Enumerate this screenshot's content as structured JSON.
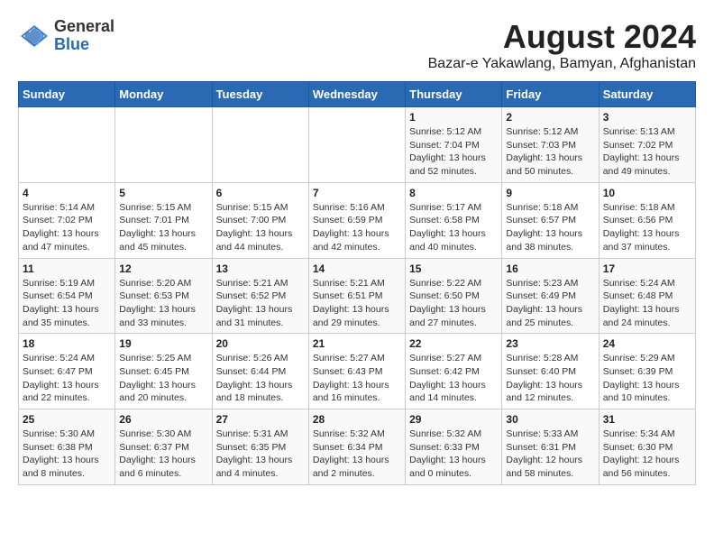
{
  "logo": {
    "general": "General",
    "blue": "Blue"
  },
  "title": "August 2024",
  "subtitle": "Bazar-e Yakawlang, Bamyan, Afghanistan",
  "calendar": {
    "headers": [
      "Sunday",
      "Monday",
      "Tuesday",
      "Wednesday",
      "Thursday",
      "Friday",
      "Saturday"
    ],
    "weeks": [
      [
        {
          "day": "",
          "info": ""
        },
        {
          "day": "",
          "info": ""
        },
        {
          "day": "",
          "info": ""
        },
        {
          "day": "",
          "info": ""
        },
        {
          "day": "1",
          "info": "Sunrise: 5:12 AM\nSunset: 7:04 PM\nDaylight: 13 hours\nand 52 minutes."
        },
        {
          "day": "2",
          "info": "Sunrise: 5:12 AM\nSunset: 7:03 PM\nDaylight: 13 hours\nand 50 minutes."
        },
        {
          "day": "3",
          "info": "Sunrise: 5:13 AM\nSunset: 7:02 PM\nDaylight: 13 hours\nand 49 minutes."
        }
      ],
      [
        {
          "day": "4",
          "info": "Sunrise: 5:14 AM\nSunset: 7:02 PM\nDaylight: 13 hours\nand 47 minutes."
        },
        {
          "day": "5",
          "info": "Sunrise: 5:15 AM\nSunset: 7:01 PM\nDaylight: 13 hours\nand 45 minutes."
        },
        {
          "day": "6",
          "info": "Sunrise: 5:15 AM\nSunset: 7:00 PM\nDaylight: 13 hours\nand 44 minutes."
        },
        {
          "day": "7",
          "info": "Sunrise: 5:16 AM\nSunset: 6:59 PM\nDaylight: 13 hours\nand 42 minutes."
        },
        {
          "day": "8",
          "info": "Sunrise: 5:17 AM\nSunset: 6:58 PM\nDaylight: 13 hours\nand 40 minutes."
        },
        {
          "day": "9",
          "info": "Sunrise: 5:18 AM\nSunset: 6:57 PM\nDaylight: 13 hours\nand 38 minutes."
        },
        {
          "day": "10",
          "info": "Sunrise: 5:18 AM\nSunset: 6:56 PM\nDaylight: 13 hours\nand 37 minutes."
        }
      ],
      [
        {
          "day": "11",
          "info": "Sunrise: 5:19 AM\nSunset: 6:54 PM\nDaylight: 13 hours\nand 35 minutes."
        },
        {
          "day": "12",
          "info": "Sunrise: 5:20 AM\nSunset: 6:53 PM\nDaylight: 13 hours\nand 33 minutes."
        },
        {
          "day": "13",
          "info": "Sunrise: 5:21 AM\nSunset: 6:52 PM\nDaylight: 13 hours\nand 31 minutes."
        },
        {
          "day": "14",
          "info": "Sunrise: 5:21 AM\nSunset: 6:51 PM\nDaylight: 13 hours\nand 29 minutes."
        },
        {
          "day": "15",
          "info": "Sunrise: 5:22 AM\nSunset: 6:50 PM\nDaylight: 13 hours\nand 27 minutes."
        },
        {
          "day": "16",
          "info": "Sunrise: 5:23 AM\nSunset: 6:49 PM\nDaylight: 13 hours\nand 25 minutes."
        },
        {
          "day": "17",
          "info": "Sunrise: 5:24 AM\nSunset: 6:48 PM\nDaylight: 13 hours\nand 24 minutes."
        }
      ],
      [
        {
          "day": "18",
          "info": "Sunrise: 5:24 AM\nSunset: 6:47 PM\nDaylight: 13 hours\nand 22 minutes."
        },
        {
          "day": "19",
          "info": "Sunrise: 5:25 AM\nSunset: 6:45 PM\nDaylight: 13 hours\nand 20 minutes."
        },
        {
          "day": "20",
          "info": "Sunrise: 5:26 AM\nSunset: 6:44 PM\nDaylight: 13 hours\nand 18 minutes."
        },
        {
          "day": "21",
          "info": "Sunrise: 5:27 AM\nSunset: 6:43 PM\nDaylight: 13 hours\nand 16 minutes."
        },
        {
          "day": "22",
          "info": "Sunrise: 5:27 AM\nSunset: 6:42 PM\nDaylight: 13 hours\nand 14 minutes."
        },
        {
          "day": "23",
          "info": "Sunrise: 5:28 AM\nSunset: 6:40 PM\nDaylight: 13 hours\nand 12 minutes."
        },
        {
          "day": "24",
          "info": "Sunrise: 5:29 AM\nSunset: 6:39 PM\nDaylight: 13 hours\nand 10 minutes."
        }
      ],
      [
        {
          "day": "25",
          "info": "Sunrise: 5:30 AM\nSunset: 6:38 PM\nDaylight: 13 hours\nand 8 minutes."
        },
        {
          "day": "26",
          "info": "Sunrise: 5:30 AM\nSunset: 6:37 PM\nDaylight: 13 hours\nand 6 minutes."
        },
        {
          "day": "27",
          "info": "Sunrise: 5:31 AM\nSunset: 6:35 PM\nDaylight: 13 hours\nand 4 minutes."
        },
        {
          "day": "28",
          "info": "Sunrise: 5:32 AM\nSunset: 6:34 PM\nDaylight: 13 hours\nand 2 minutes."
        },
        {
          "day": "29",
          "info": "Sunrise: 5:32 AM\nSunset: 6:33 PM\nDaylight: 13 hours\nand 0 minutes."
        },
        {
          "day": "30",
          "info": "Sunrise: 5:33 AM\nSunset: 6:31 PM\nDaylight: 12 hours\nand 58 minutes."
        },
        {
          "day": "31",
          "info": "Sunrise: 5:34 AM\nSunset: 6:30 PM\nDaylight: 12 hours\nand 56 minutes."
        }
      ]
    ]
  }
}
